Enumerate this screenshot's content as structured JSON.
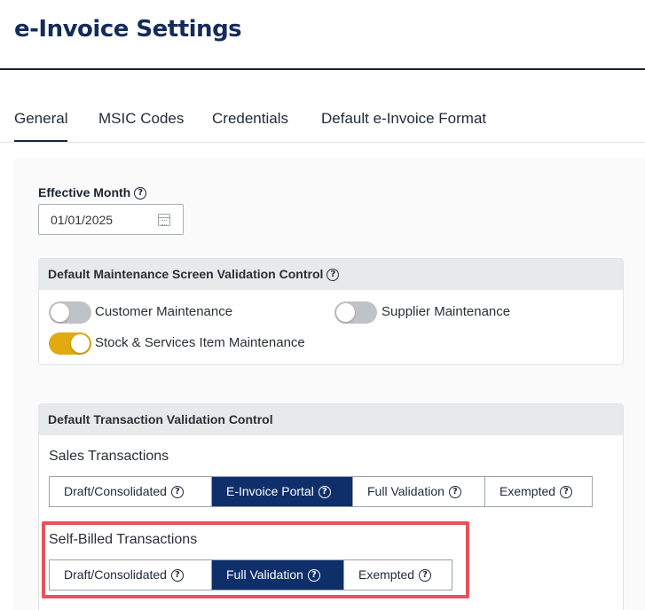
{
  "header": {
    "title": "e-Invoice Settings"
  },
  "tabs": [
    {
      "label": "General",
      "active": true
    },
    {
      "label": "MSIC Codes",
      "active": false
    },
    {
      "label": "Credentials",
      "active": false
    },
    {
      "label": "Default e-Invoice Format",
      "active": false
    }
  ],
  "effective_month": {
    "label": "Effective Month",
    "value": "01/01/2025",
    "icon": "calendar-icon"
  },
  "maintenance_panel": {
    "title": "Default Maintenance Screen Validation Control",
    "toggles": [
      {
        "label": "Customer Maintenance",
        "on": false
      },
      {
        "label": "Supplier Maintenance",
        "on": false
      },
      {
        "label": "Stock & Services Item Maintenance",
        "on": true
      }
    ]
  },
  "transaction_panel": {
    "title": "Default Transaction Validation Control",
    "sales": {
      "title": "Sales Transactions",
      "options": [
        "Draft/Consolidated",
        "E-Invoice Portal",
        "Full Validation",
        "Exempted"
      ],
      "selected": "E-Invoice Portal"
    },
    "self_billed": {
      "title": "Self-Billed Transactions",
      "options": [
        "Draft/Consolidated",
        "Full Validation",
        "Exempted"
      ],
      "selected": "Full Validation"
    }
  },
  "colors": {
    "brand": "#142b5c",
    "selected_segment": "#0f2f6b",
    "toggle_on": "#e1aa10",
    "highlight": "#e8525a"
  }
}
